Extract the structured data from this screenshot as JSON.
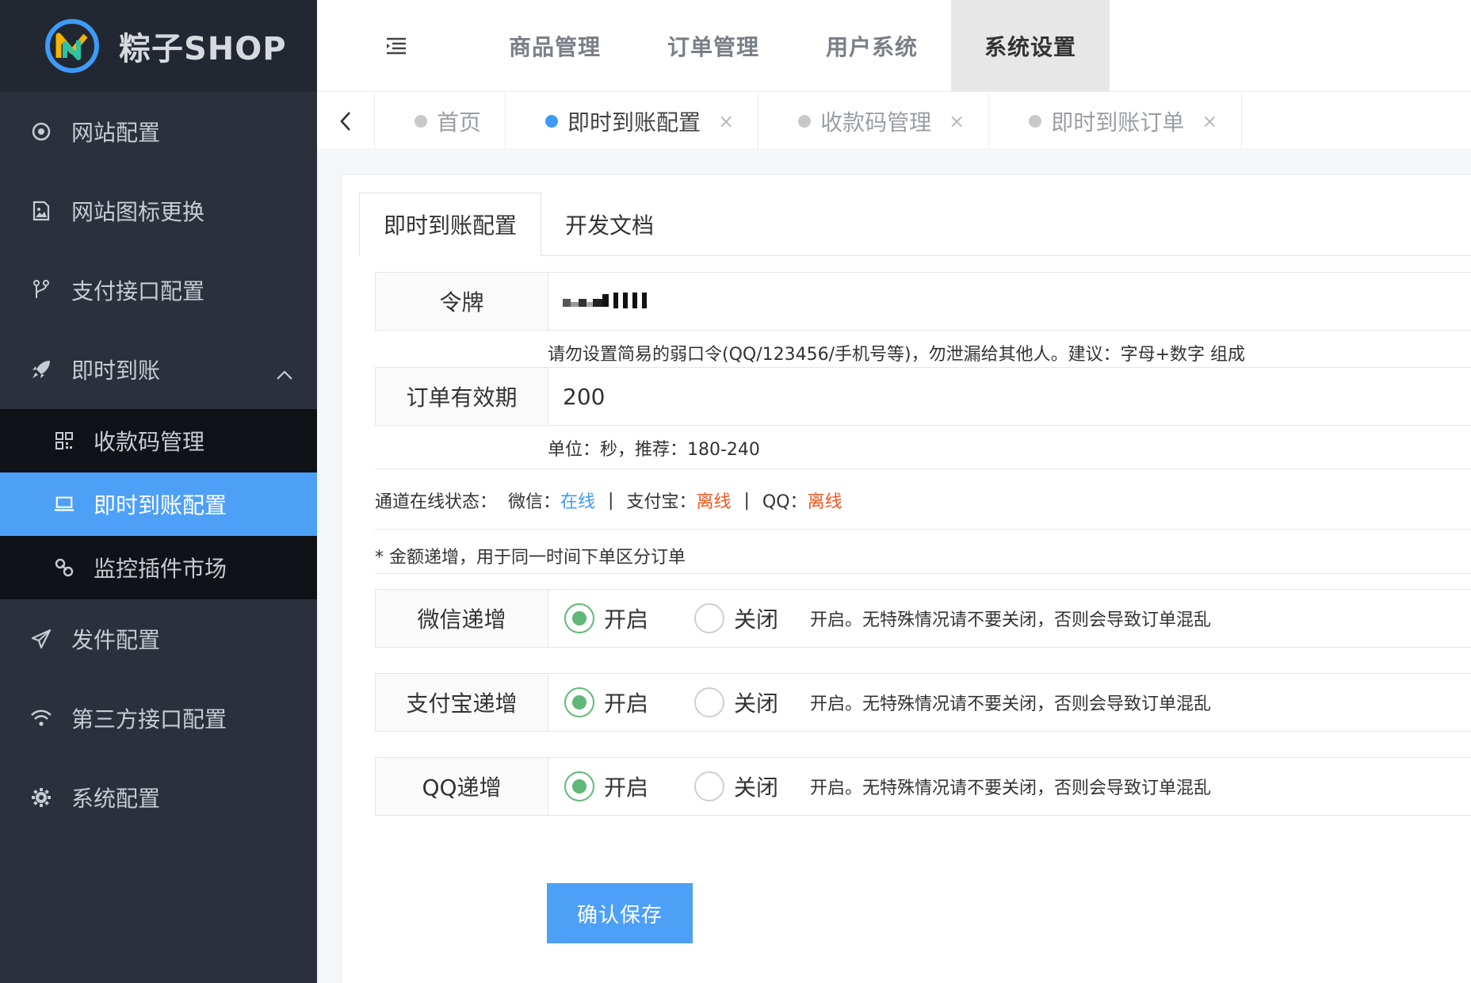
{
  "brand": {
    "name": "粽子SHOP"
  },
  "sidebar": {
    "items": [
      {
        "label": "网站配置"
      },
      {
        "label": "网站图标更换"
      },
      {
        "label": "支付接口配置"
      },
      {
        "label": "即时到账"
      },
      {
        "label": "发件配置"
      },
      {
        "label": "第三方接口配置"
      },
      {
        "label": "系统配置"
      }
    ],
    "subitems": [
      {
        "label": "收款码管理"
      },
      {
        "label": "即时到账配置"
      },
      {
        "label": "监控插件市场"
      }
    ]
  },
  "topnav": {
    "tabs": [
      {
        "label": "商品管理"
      },
      {
        "label": "订单管理"
      },
      {
        "label": "用户系统"
      },
      {
        "label": "系统设置"
      }
    ]
  },
  "pagetabs": [
    {
      "label": "首页"
    },
    {
      "label": "即时到账配置",
      "close": "×"
    },
    {
      "label": "收款码管理",
      "close": "×"
    },
    {
      "label": "即时到账订单",
      "close": "×"
    }
  ],
  "cardtabs": [
    {
      "label": "即时到账配置"
    },
    {
      "label": "开发文档"
    }
  ],
  "form": {
    "token": {
      "label": "令牌",
      "hint": "请勿设置简易的弱口令(QQ/123456/手机号等)，勿泄漏给其他人。建议：字母+数字 组成"
    },
    "expiry": {
      "label": "订单有效期",
      "value": "200",
      "hint": "单位：秒，推荐：180-240"
    },
    "status": {
      "prefix": "通道在线状态：",
      "wechat_label": "微信：",
      "wechat_state": "在线",
      "alipay_label": "支付宝：",
      "alipay_state": "离线",
      "qq_label": "QQ：",
      "qq_state": "离线",
      "separator": "|"
    },
    "note": "* 金额递增，用于同一时间下单区分订单",
    "increments": [
      {
        "label": "微信递增",
        "on": "开启",
        "off": "关闭",
        "hint": "开启。无特殊情况请不要关闭，否则会导致订单混乱"
      },
      {
        "label": "支付宝递增",
        "on": "开启",
        "off": "关闭",
        "hint": "开启。无特殊情况请不要关闭，否则会导致订单混乱"
      },
      {
        "label": "QQ递增",
        "on": "开启",
        "off": "关闭",
        "hint": "开启。无特殊情况请不要关闭，否则会导致订单混乱"
      }
    ],
    "save_label": "确认保存"
  },
  "colors": {
    "sidebar_bg": "#2a313d",
    "accent": "#4ea0f7",
    "online": "#3f9af7",
    "offline": "#f0561f",
    "radio_checked": "#5fb878"
  }
}
